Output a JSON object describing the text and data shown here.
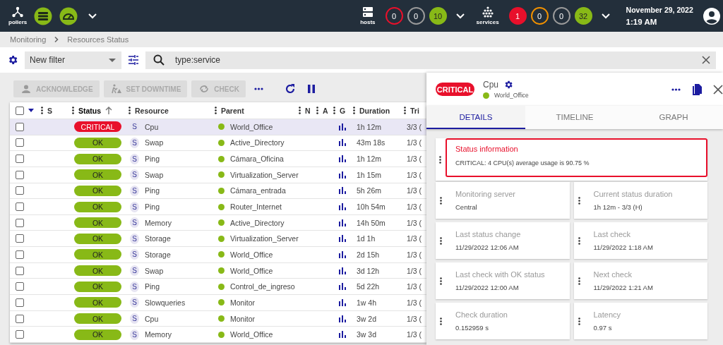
{
  "top_bar": {
    "pollers_label": "pollers",
    "hosts": {
      "label": "hosts",
      "counters": [
        {
          "value": "0",
          "color": "#e8102b",
          "filled": false
        },
        {
          "value": "0",
          "color": "#9a9a9a",
          "filled": false
        },
        {
          "value": "10",
          "color": "#88b917",
          "filled": true
        }
      ]
    },
    "services": {
      "label": "services",
      "counters": [
        {
          "value": "1",
          "color": "#e8102b",
          "filled": true
        },
        {
          "value": "0",
          "color": "#f09000",
          "filled": false
        },
        {
          "value": "0",
          "color": "#9a9a9a",
          "filled": false
        },
        {
          "value": "32",
          "color": "#88b917",
          "filled": true
        }
      ]
    },
    "date": "November 29, 2022",
    "time": "1:19 AM"
  },
  "breadcrumb": [
    "Monitoring",
    "Resources Status"
  ],
  "filter": {
    "selected_filter": "New filter",
    "search_value": "type:service"
  },
  "actions": [
    {
      "kind": "acknowledge",
      "label": "ACKNOWLEDGE",
      "disabled": true
    },
    {
      "kind": "downtime",
      "label": "SET DOWNTIME",
      "disabled": true
    },
    {
      "kind": "check",
      "label": "CHECK",
      "disabled": true
    }
  ],
  "table": {
    "all_checked": false,
    "columns": [
      {
        "label": "S",
        "sorted": false
      },
      {
        "label": "Status",
        "sorted": true
      },
      {
        "label": "Resource",
        "sorted": false
      },
      {
        "label": "Parent",
        "sorted": false
      },
      {
        "label": "N",
        "sorted": false
      },
      {
        "label": "A",
        "sorted": false
      },
      {
        "label": "G",
        "sorted": false
      },
      {
        "label": "Duration",
        "sorted": false
      },
      {
        "label": "Tri",
        "sorted": false
      }
    ],
    "rows": [
      {
        "selected": true,
        "checked": false,
        "status": "CRITICAL",
        "kind": "critical",
        "type": "S",
        "resource": "Cpu",
        "parent": "World_Office",
        "duration": "1h 12m",
        "tries": "3/3 ("
      },
      {
        "selected": false,
        "checked": false,
        "status": "OK",
        "kind": "ok",
        "type": "S",
        "resource": "Swap",
        "parent": "Active_Directory",
        "duration": "43m 18s",
        "tries": "1/3 ("
      },
      {
        "selected": false,
        "checked": false,
        "status": "OK",
        "kind": "ok",
        "type": "S",
        "resource": "Ping",
        "parent": "Cámara_Oficina",
        "duration": "1h 12m",
        "tries": "1/3 ("
      },
      {
        "selected": false,
        "checked": false,
        "status": "OK",
        "kind": "ok",
        "type": "S",
        "resource": "Swap",
        "parent": "Virtualization_Server",
        "duration": "1h 15m",
        "tries": "1/3 ("
      },
      {
        "selected": false,
        "checked": false,
        "status": "OK",
        "kind": "ok",
        "type": "S",
        "resource": "Ping",
        "parent": "Cámara_entrada",
        "duration": "5h 26m",
        "tries": "1/3 ("
      },
      {
        "selected": false,
        "checked": false,
        "status": "OK",
        "kind": "ok",
        "type": "S",
        "resource": "Ping",
        "parent": "Router_Internet",
        "duration": "10h 54m",
        "tries": "1/3 ("
      },
      {
        "selected": false,
        "checked": false,
        "status": "OK",
        "kind": "ok",
        "type": "S",
        "resource": "Memory",
        "parent": "Active_Directory",
        "duration": "14h 50m",
        "tries": "1/3 ("
      },
      {
        "selected": false,
        "checked": false,
        "status": "OK",
        "kind": "ok",
        "type": "S",
        "resource": "Storage",
        "parent": "Virtualization_Server",
        "duration": "1d 1h",
        "tries": "1/3 ("
      },
      {
        "selected": false,
        "checked": false,
        "status": "OK",
        "kind": "ok",
        "type": "S",
        "resource": "Storage",
        "parent": "World_Office",
        "duration": "2d 15h",
        "tries": "1/3 ("
      },
      {
        "selected": false,
        "checked": false,
        "status": "OK",
        "kind": "ok",
        "type": "S",
        "resource": "Swap",
        "parent": "World_Office",
        "duration": "3d 12h",
        "tries": "1/3 ("
      },
      {
        "selected": false,
        "checked": false,
        "status": "OK",
        "kind": "ok",
        "type": "S",
        "resource": "Ping",
        "parent": "Control_de_ingreso",
        "duration": "5d 22h",
        "tries": "1/3 ("
      },
      {
        "selected": false,
        "checked": false,
        "status": "OK",
        "kind": "ok",
        "type": "S",
        "resource": "Slowqueries",
        "parent": "Monitor",
        "duration": "1w 4h",
        "tries": "1/3 ("
      },
      {
        "selected": false,
        "checked": false,
        "status": "OK",
        "kind": "ok",
        "type": "S",
        "resource": "Cpu",
        "parent": "Monitor",
        "duration": "3w 2d",
        "tries": "1/3 ("
      },
      {
        "selected": false,
        "checked": false,
        "status": "OK",
        "kind": "ok",
        "type": "S",
        "resource": "Memory",
        "parent": "World_Office",
        "duration": "3w 3d",
        "tries": "1/3 ("
      }
    ]
  },
  "panel": {
    "status": "CRITICAL",
    "kind": "critical",
    "resource": "Cpu",
    "parent": "World_Office",
    "tabs": [
      {
        "label": "DETAILS",
        "selected": true
      },
      {
        "label": "TIMELINE",
        "selected": false
      },
      {
        "label": "GRAPH",
        "selected": false
      }
    ],
    "status_information": {
      "title": "Status information",
      "text": "CRITICAL: 4 CPU(s) average usage is 90.75 %"
    },
    "details": [
      {
        "label": "Monitoring server",
        "value": "Central"
      },
      {
        "label": "Current status duration",
        "value": "1h 12m - 3/3 (H)"
      },
      {
        "label": "Last status change",
        "value": "11/29/2022 12:06 AM"
      },
      {
        "label": "Last check",
        "value": "11/29/2022 1:18 AM"
      },
      {
        "label": "Last check with OK status",
        "value": "11/29/2022 12:00 AM"
      },
      {
        "label": "Next check",
        "value": "11/29/2022 1:21 AM"
      },
      {
        "label": "Check duration",
        "value": "0.152959 s"
      },
      {
        "label": "Latency",
        "value": "0.97 s"
      }
    ]
  }
}
